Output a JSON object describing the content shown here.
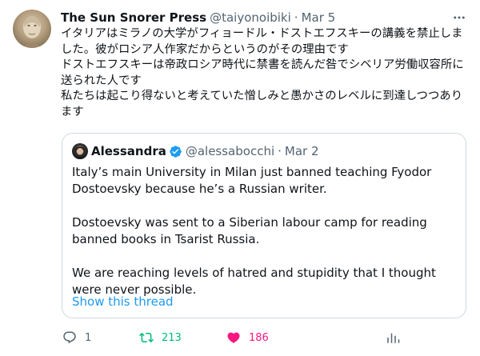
{
  "author": {
    "display_name": "The Sun Snorer Press",
    "handle": "@taiyonoibiki",
    "separator": "·",
    "date": "Mar 5"
  },
  "body_lines": [
    "イタリアはミラノの大学がフィョードル・ドストエフスキーの講義を禁止しました。彼がロシア人作家だからというのがその理由です",
    "ドストエフスキーは帝政ロシア時代に禁書を読んだ咎でシベリア労働収容所に送られた人です",
    "私たちは起こり得ないと考えていた憎しみと愚かさのレベルに到達しつつあります"
  ],
  "quoted": {
    "display_name": "Alessandra",
    "handle": "@alessabocchi",
    "separator": "·",
    "date": "Mar 2",
    "paragraphs": [
      "Italy’s main University in Milan just banned teaching Fyodor Dostoevsky because he’s a Russian writer.",
      "Dostoevsky was sent to a Siberian labour camp for reading banned books in Tsarist Russia.",
      "We are reaching levels of hatred and stupidity that I thought were never possible."
    ],
    "show_thread": "Show this thread"
  },
  "actions": {
    "reply_count": "1",
    "retweet_count": "213",
    "like_count": "186"
  },
  "icons": {
    "more": "more-icon",
    "verified": "verified-badge-icon",
    "reply": "reply-icon",
    "retweet": "retweet-icon",
    "like": "heart-icon",
    "share": "analytics-icon"
  },
  "colors": {
    "accent": "#1d9bf0",
    "retweet": "#00ba7c",
    "like": "#f91880",
    "secondary_text": "#536471"
  }
}
